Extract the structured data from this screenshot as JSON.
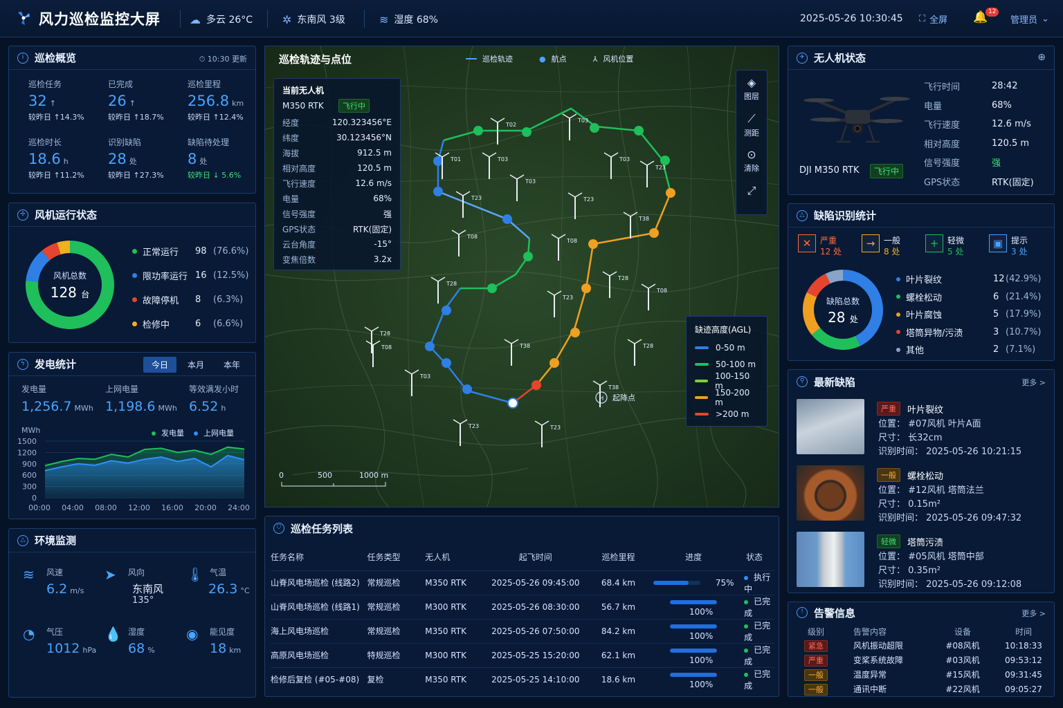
{
  "header": {
    "title": "风力巡检监控大屏",
    "weather": "多云 26°C",
    "wind": "东南风 3级",
    "humidity": "湿度 68%",
    "datetime": "2025-05-26  10:30:45",
    "fullscreen": "全屏",
    "alert_count": "12",
    "user": "管理员"
  },
  "overview": {
    "title": "巡检概览",
    "updated": "10:30 更新",
    "stats": [
      {
        "label": "巡检任务",
        "value": "32",
        "unit": "↑",
        "delta": "较昨日 ↑14.3%"
      },
      {
        "label": "已完成",
        "value": "26",
        "unit": "↑",
        "delta": "较昨日 ↑18.7%"
      },
      {
        "label": "巡检里程",
        "value": "256.8",
        "unit": "km",
        "delta": "较昨日 ↑12.4%"
      },
      {
        "label": "巡检时长",
        "value": "18.6",
        "unit": "h",
        "delta": "较昨日 ↑11.2%"
      },
      {
        "label": "识别缺陷",
        "value": "28",
        "unit": "处",
        "delta": "较昨日 ↑27.3%"
      },
      {
        "label": "缺陷待处理",
        "value": "8",
        "unit": "处",
        "delta": "较昨日 ↓ 5.6%"
      }
    ]
  },
  "turbine_status": {
    "title": "风机运行状态",
    "center_label": "风机总数",
    "total": "128",
    "total_unit": "台",
    "items": [
      {
        "label": "正常运行",
        "count": "98",
        "pct": "(76.6%)",
        "value": 98,
        "color": "#1fbf5c"
      },
      {
        "label": "限功率运行",
        "count": "16",
        "pct": "(12.5%)",
        "value": 16,
        "color": "#2f7fe6"
      },
      {
        "label": "故障停机",
        "count": "8",
        "pct": "(6.3%)",
        "value": 8,
        "color": "#e5452f"
      },
      {
        "label": "检修中",
        "count": "6",
        "pct": "(6.6%)",
        "value": 6,
        "color": "#f0b020"
      }
    ]
  },
  "generation": {
    "title": "发电统计",
    "tabs": [
      "今日",
      "本月",
      "本年"
    ],
    "stats": [
      {
        "label": "发电量",
        "value": "1,256.7",
        "unit": "MWh"
      },
      {
        "label": "上网电量",
        "value": "1,198.6",
        "unit": "MWh"
      },
      {
        "label": "等效满发小时",
        "value": "6.52",
        "unit": "h"
      }
    ]
  },
  "chart_data": {
    "type": "area",
    "ylabel": "MWh",
    "ylim": [
      0,
      1500
    ],
    "yticks": [
      "1500",
      "1200",
      "900",
      "600",
      "300",
      "0"
    ],
    "xticks": [
      "00:00",
      "04:00",
      "08:00",
      "12:00",
      "16:00",
      "20:00",
      "24:00"
    ],
    "x": [
      0,
      2,
      4,
      6,
      8,
      10,
      12,
      14,
      16,
      18,
      20,
      22,
      24
    ],
    "series": [
      {
        "name": "发电量",
        "color": "#1fbf5c",
        "values": [
          850,
          960,
          1040,
          1020,
          1150,
          1080,
          1280,
          1310,
          1200,
          1260,
          1150,
          1340,
          1290
        ]
      },
      {
        "name": "上网电量",
        "color": "#2f8fff",
        "values": [
          720,
          820,
          900,
          860,
          980,
          920,
          1020,
          1080,
          960,
          1040,
          820,
          1120,
          1010
        ]
      }
    ]
  },
  "environment": {
    "title": "环境监测",
    "items": [
      {
        "label": "风速",
        "value": "6.2",
        "unit": "m/s"
      },
      {
        "label": "风向",
        "value": "东南风",
        "unit": "135°"
      },
      {
        "label": "气温",
        "value": "26.3",
        "unit": "°C"
      },
      {
        "label": "气压",
        "value": "1012",
        "unit": "hPa"
      },
      {
        "label": "湿度",
        "value": "68",
        "unit": "%"
      },
      {
        "label": "能见度",
        "value": "18",
        "unit": "km"
      }
    ]
  },
  "map": {
    "title": "巡检轨迹与点位",
    "legend_track": "巡检轨迹",
    "legend_waypoint": "航点",
    "legend_turbine": "风机位置",
    "drone_header": "当前无人机",
    "drone_model": "M350 RTK",
    "drone_status": "飞行中",
    "drone_rows": [
      {
        "k": "经度",
        "v": "120.323456°E"
      },
      {
        "k": "纬度",
        "v": "30.123456°N"
      },
      {
        "k": "海拔",
        "v": "912.5 m"
      },
      {
        "k": "相对高度",
        "v": "120.5 m"
      },
      {
        "k": "飞行速度",
        "v": "12.6 m/s"
      },
      {
        "k": "电量",
        "v": "68%"
      },
      {
        "k": "信号强度",
        "v": "强"
      },
      {
        "k": "GPS状态",
        "v": "RTK(固定)"
      },
      {
        "k": "云台角度",
        "v": "-15°"
      },
      {
        "k": "变焦倍数",
        "v": "3.2x"
      }
    ],
    "tools": [
      "图层",
      "测距",
      "清除"
    ],
    "altitude_title": "缺迹高度(AGL)",
    "altitude_legend": [
      {
        "label": "0-50 m",
        "color": "#2f7fe6"
      },
      {
        "label": "50-100 m",
        "color": "#1fbf5c"
      },
      {
        "label": "100-150 m",
        "color": "#7ccf3a"
      },
      {
        "label": "150-200 m",
        "color": "#f0a020"
      },
      {
        "label": ">200 m",
        "color": "#e5452f"
      }
    ],
    "takeoff": "起降点",
    "scale": [
      "0",
      "500",
      "1000 m"
    ],
    "turbines": [
      "T02",
      "T03",
      "T01",
      "T03",
      "T03",
      "T23",
      "T23",
      "T03",
      "T08",
      "T08",
      "T28",
      "T38",
      "T23",
      "T28",
      "T08",
      "T38",
      "T08",
      "T28",
      "T03",
      "T38",
      "T23",
      "T23",
      "T28",
      "T23"
    ],
    "waypoint_label": "18"
  },
  "tasks": {
    "title": "巡检任务列表",
    "headers": [
      "任务名称",
      "任务类型",
      "无人机",
      "起飞时间",
      "巡检里程",
      "进度",
      "状态"
    ],
    "rows": [
      {
        "name": "山脊风电场巡检 (线路2)",
        "type": "常规巡检",
        "drone": "M350 RTK",
        "time": "2025-05-26  09:45:00",
        "dist": "68.4 km",
        "progress": 0.75,
        "pct": "75%",
        "status": "执行中",
        "scolor": "#2f8fff"
      },
      {
        "name": "山脊风电场巡检 (线路1)",
        "type": "常规巡检",
        "drone": "M300 RTK",
        "time": "2025-05-26  08:30:00",
        "dist": "56.7 km",
        "progress": 1.0,
        "pct": "100%",
        "status": "已完成",
        "scolor": "#1fbf5c"
      },
      {
        "name": "海上风电场巡检",
        "type": "常规巡检",
        "drone": "M350 RTK",
        "time": "2025-05-26  07:50:00",
        "dist": "84.2 km",
        "progress": 1.0,
        "pct": "100%",
        "status": "已完成",
        "scolor": "#1fbf5c"
      },
      {
        "name": "高原风电场巡检",
        "type": "特规巡检",
        "drone": "M300 RTK",
        "time": "2025-05-25  15:20:00",
        "dist": "62.1 km",
        "progress": 1.0,
        "pct": "100%",
        "status": "已完成",
        "scolor": "#1fbf5c"
      },
      {
        "name": "检修后复检 (#05-#08)",
        "type": "复检",
        "drone": "M350 RTK",
        "time": "2025-05-25  14:10:00",
        "dist": "18.6 km",
        "progress": 1.0,
        "pct": "100%",
        "status": "已完成",
        "scolor": "#1fbf5c"
      }
    ]
  },
  "uav": {
    "title": "无人机状态",
    "model": "DJI M350 RTK",
    "status": "飞行中",
    "rows": [
      {
        "k": "飞行时间",
        "v": "28:42"
      },
      {
        "k": "电量",
        "v": "68%"
      },
      {
        "k": "飞行速度",
        "v": "12.6 m/s"
      },
      {
        "k": "相对高度",
        "v": "120.5 m"
      },
      {
        "k": "信号强度",
        "v": "强"
      },
      {
        "k": "GPS状态",
        "v": "RTK(固定)"
      }
    ]
  },
  "defect_stats": {
    "title": "缺陷识别统计",
    "levels": [
      {
        "label": "严重",
        "count": "12 处",
        "color": "#ff6b3b"
      },
      {
        "label": "一般",
        "count": "8 处",
        "color": "#f0b020"
      },
      {
        "label": "轻微",
        "count": "5 处",
        "color": "#1fbf5c"
      },
      {
        "label": "提示",
        "count": "3 处",
        "color": "#4aa3ff"
      }
    ],
    "center_label": "缺陷总数",
    "total": "28",
    "total_unit": "处",
    "items": [
      {
        "label": "叶片裂纹",
        "count": "12",
        "pct": "(42.9%)",
        "value": 12,
        "color": "#2f7fe6"
      },
      {
        "label": "螺栓松动",
        "count": "6",
        "pct": "(21.4%)",
        "value": 6,
        "color": "#1fbf5c"
      },
      {
        "label": "叶片腐蚀",
        "count": "5",
        "pct": "(17.9%)",
        "value": 5,
        "color": "#f0a020"
      },
      {
        "label": "塔筒异物/污渍",
        "count": "3",
        "pct": "(10.7%)",
        "value": 3,
        "color": "#e5452f"
      },
      {
        "label": "其他",
        "count": "2",
        "pct": "(7.1%)",
        "value": 2,
        "color": "#8aa4c8"
      }
    ]
  },
  "latest_defects": {
    "title": "最新缺陷",
    "more": "更多 >",
    "items": [
      {
        "sev": "严重",
        "sevclass": "sev-red",
        "name": "叶片裂纹",
        "pos": "位置：  #07风机  叶片A面",
        "size": "尺寸：  长32cm",
        "time": "识别时间：  2025-05-26  10:21:15"
      },
      {
        "sev": "一般",
        "sevclass": "sev-orange",
        "name": "螺栓松动",
        "pos": "位置：  #12风机  塔筒法兰",
        "size": "尺寸：  0.15m²",
        "time": "识别时间：  2025-05-26  09:47:32"
      },
      {
        "sev": "轻微",
        "sevclass": "sev-green",
        "name": "塔筒污渍",
        "pos": "位置：  #05风机  塔筒中部",
        "size": "尺寸：  0.35m²",
        "time": "识别时间：  2025-05-26  09:12:08"
      }
    ]
  },
  "alerts": {
    "title": "告警信息",
    "more": "更多 >",
    "headers": [
      "级别",
      "告警内容",
      "设备",
      "时间"
    ],
    "rows": [
      {
        "level": "紧急",
        "cls": "sev-red",
        "content": "风机振动超限",
        "device": "#08风机",
        "time": "10:18:33"
      },
      {
        "level": "严重",
        "cls": "sev-red",
        "content": "变桨系统故障",
        "device": "#03风机",
        "time": "09:53:12"
      },
      {
        "level": "一般",
        "cls": "sev-orange",
        "content": "温度异常",
        "device": "#15风机",
        "time": "09:31:45"
      },
      {
        "level": "一般",
        "cls": "sev-orange",
        "content": "通讯中断",
        "device": "#22风机",
        "time": "09:05:27"
      }
    ]
  }
}
